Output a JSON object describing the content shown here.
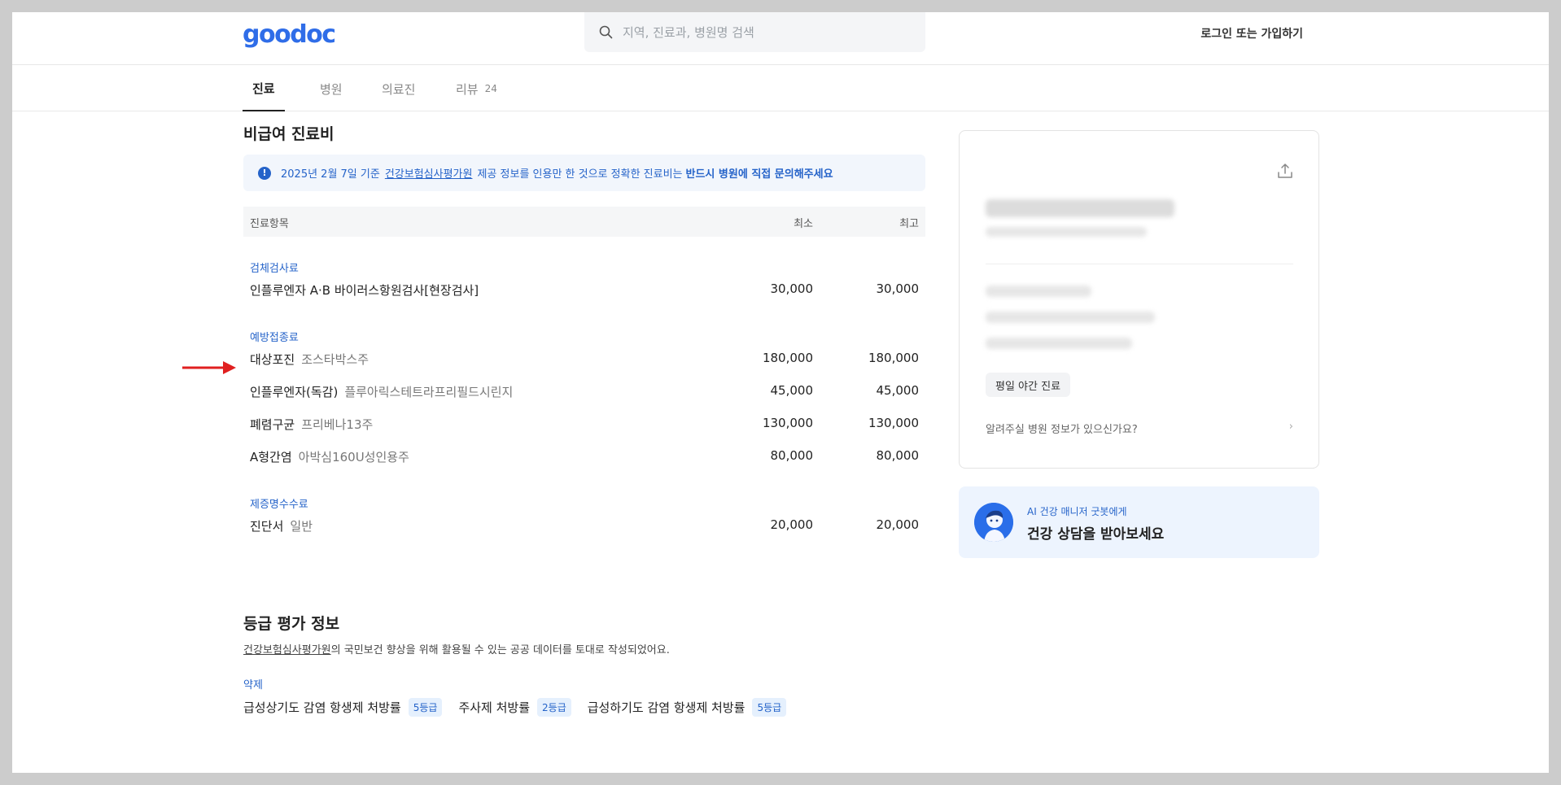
{
  "header": {
    "logo_text": "goodoc",
    "search_placeholder": "지역, 진료과, 병원명 검색",
    "login_label": "로그인 또는 가입하기"
  },
  "tabs": [
    {
      "label": "진료",
      "active": true
    },
    {
      "label": "병원"
    },
    {
      "label": "의료진"
    },
    {
      "label": "리뷰",
      "count": "24"
    }
  ],
  "fees": {
    "title": "비급여 진료비",
    "notice": {
      "date": "2025년 2월 7일 기준",
      "source": "건강보험심사평가원",
      "middle": "제공 정보를 인용만 한 것으로 정확한 진료비는",
      "strong": "반드시 병원에 직접 문의해주세요"
    },
    "columns": {
      "item": "진료항목",
      "min": "최소",
      "max": "최고"
    },
    "categories": [
      {
        "name": "검체검사료",
        "rows": [
          {
            "name": "인플루엔자 A·B 바이러스항원검사[현장검사]",
            "sub": "",
            "min": "30,000",
            "max": "30,000"
          }
        ]
      },
      {
        "name": "예방접종료",
        "rows": [
          {
            "name": "대상포진",
            "sub": "조스타박스주",
            "min": "180,000",
            "max": "180,000"
          },
          {
            "name": "인플루엔자(독감)",
            "sub": "플루아릭스테트라프리필드시린지",
            "min": "45,000",
            "max": "45,000"
          },
          {
            "name": "폐렴구균",
            "sub": "프리베나13주",
            "min": "130,000",
            "max": "130,000"
          },
          {
            "name": "A형간염",
            "sub": "아박심160U성인용주",
            "min": "80,000",
            "max": "80,000"
          }
        ]
      },
      {
        "name": "제증명수수료",
        "rows": [
          {
            "name": "진단서",
            "sub": "일반",
            "min": "20,000",
            "max": "20,000"
          }
        ]
      }
    ]
  },
  "grade": {
    "title": "등급 평가 정보",
    "source": "건강보험심사평가원",
    "desc": "의 국민보건 향상을 위해 활용될 수 있는 공공 데이터를 토대로 작성되었어요.",
    "category": "약제",
    "items": [
      {
        "label": "급성상기도 감염 항생제 처방률",
        "grade": "5등급"
      },
      {
        "label": "주사제 처방률",
        "grade": "2등급"
      },
      {
        "label": "급성하기도 감염 항생제 처방률",
        "grade": "5등급"
      }
    ]
  },
  "hospital_card": {
    "chip": "평일 야간 진료",
    "feedback": "알려주실 병원 정보가 있으신가요?"
  },
  "ai_banner": {
    "sub": "AI 건강 매니저 굿봇에게",
    "main": "건강 상담을 받아보세요"
  },
  "colors": {
    "accent": "#2563c9",
    "logo": "#2f6de8",
    "arrow": "#e02020"
  }
}
